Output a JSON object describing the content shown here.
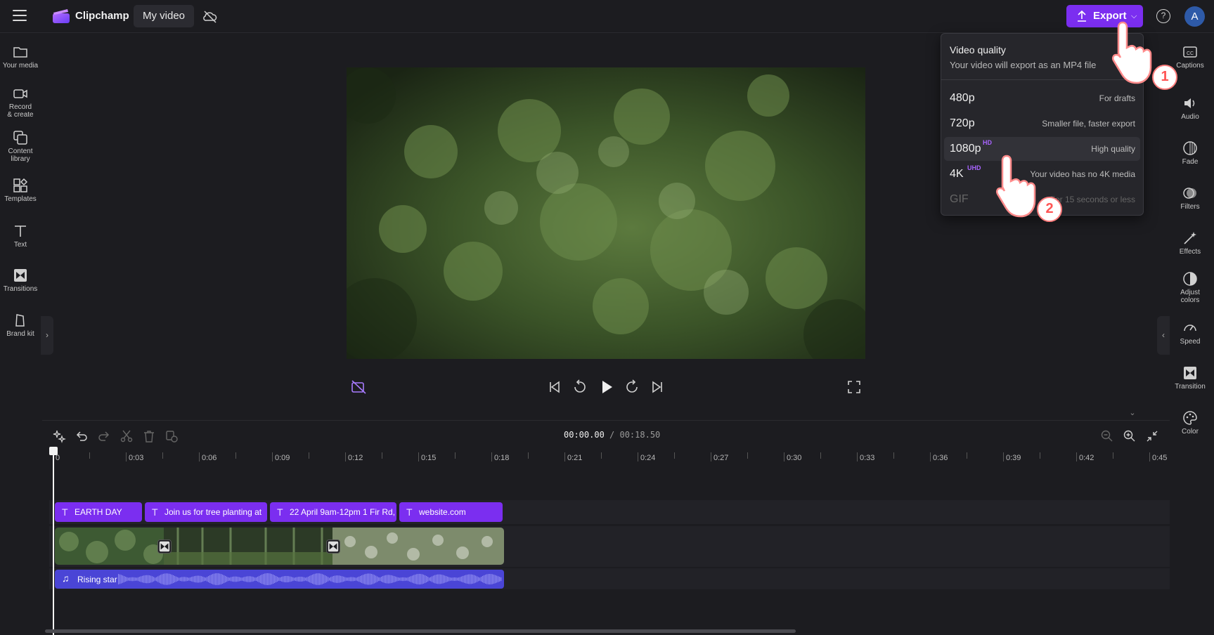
{
  "app": {
    "name": "Clipchamp",
    "project_name": "My video"
  },
  "header": {
    "export_label": "Export",
    "avatar_initial": "A",
    "help_label": "?"
  },
  "left_sidebar": {
    "items": [
      {
        "label": "Your media",
        "icon": "folder-icon"
      },
      {
        "label": "Record & create",
        "icon": "camera-icon"
      },
      {
        "label": "Content library",
        "icon": "library-icon"
      },
      {
        "label": "Templates",
        "icon": "templates-icon"
      },
      {
        "label": "Text",
        "icon": "text-icon"
      },
      {
        "label": "Transitions",
        "icon": "transitions-icon"
      },
      {
        "label": "Brand kit",
        "icon": "brand-kit-icon"
      }
    ]
  },
  "right_sidebar": {
    "items": [
      {
        "label": "Captions",
        "icon": "captions-icon"
      },
      {
        "label": "Audio",
        "icon": "speaker-icon"
      },
      {
        "label": "Fade",
        "icon": "fade-icon"
      },
      {
        "label": "Filters",
        "icon": "filters-icon"
      },
      {
        "label": "Effects",
        "icon": "magic-wand-icon"
      },
      {
        "label": "Adjust colors",
        "icon": "adjust-colors-icon"
      },
      {
        "label": "Speed",
        "icon": "speedometer-icon"
      },
      {
        "label": "Transition",
        "icon": "transition-icon"
      },
      {
        "label": "Color",
        "icon": "palette-icon"
      }
    ]
  },
  "export_dropdown": {
    "title": "Video quality",
    "subtitle": "Your video will export as an MP4 file",
    "options": [
      {
        "quality": "480p",
        "badge": "",
        "description": "For drafts",
        "disabled": false
      },
      {
        "quality": "720p",
        "badge": "",
        "description": "Smaller file, faster export",
        "disabled": false
      },
      {
        "quality": "1080p",
        "badge": "HD",
        "description": "High quality",
        "disabled": false,
        "highlighted": true
      },
      {
        "quality": "4K",
        "badge": "UHD",
        "description": "Your video has no 4K media",
        "disabled": false
      },
      {
        "quality": "GIF",
        "badge": "",
        "description": "For 15 seconds or less",
        "disabled": true
      }
    ]
  },
  "annotations": {
    "step1": "1",
    "step2": "2"
  },
  "timeline": {
    "current_time": "00:00.00",
    "total_time": "/ 00:18.50",
    "ruler_labels": [
      "0",
      "0:03",
      "0:06",
      "0:09",
      "0:12",
      "0:15",
      "0:18",
      "0:21",
      "0:24",
      "0:27",
      "0:30",
      "0:33",
      "0:36",
      "0:39",
      "0:42",
      "0:45"
    ],
    "text_clips": [
      "EARTH DAY",
      "Join us for tree planting at",
      "22 April 9am-12pm 1 Fir Rd,",
      "website.com"
    ],
    "audio_clip": "Rising star"
  },
  "colors": {
    "accent": "#7b2ef0",
    "audio": "#4a45d6",
    "background": "#1c1c20",
    "badge": "#a864ff"
  }
}
